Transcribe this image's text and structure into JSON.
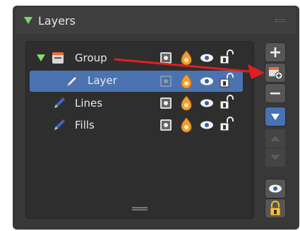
{
  "panel": {
    "title": "Layers"
  },
  "layers": [
    {
      "label": "Group",
      "type": "group",
      "selected": false
    },
    {
      "label": "Layer",
      "type": "layer",
      "selected": true
    },
    {
      "label": "Lines",
      "type": "layer",
      "selected": false
    },
    {
      "label": "Fills",
      "type": "layer",
      "selected": false
    }
  ],
  "side_buttons": [
    {
      "name": "add-layer-button",
      "label": "+"
    },
    {
      "name": "add-group-button",
      "icon": "add-group-icon"
    },
    {
      "name": "remove-layer-button",
      "label": "−"
    },
    {
      "name": "specials-menu-button",
      "icon": "chevron-down-icon"
    },
    {
      "name": "move-up-button",
      "icon": "arrow-up-icon"
    },
    {
      "name": "move-down-button",
      "icon": "arrow-down-icon"
    },
    {
      "name": "visibility-toggle-all-button",
      "icon": "eye-icon"
    },
    {
      "name": "lock-toggle-all-button",
      "icon": "lock-icon"
    }
  ],
  "colors": {
    "accent_green": "#7ad46e",
    "selection_blue": "#4b73b1",
    "annotation_red": "#e02020"
  }
}
